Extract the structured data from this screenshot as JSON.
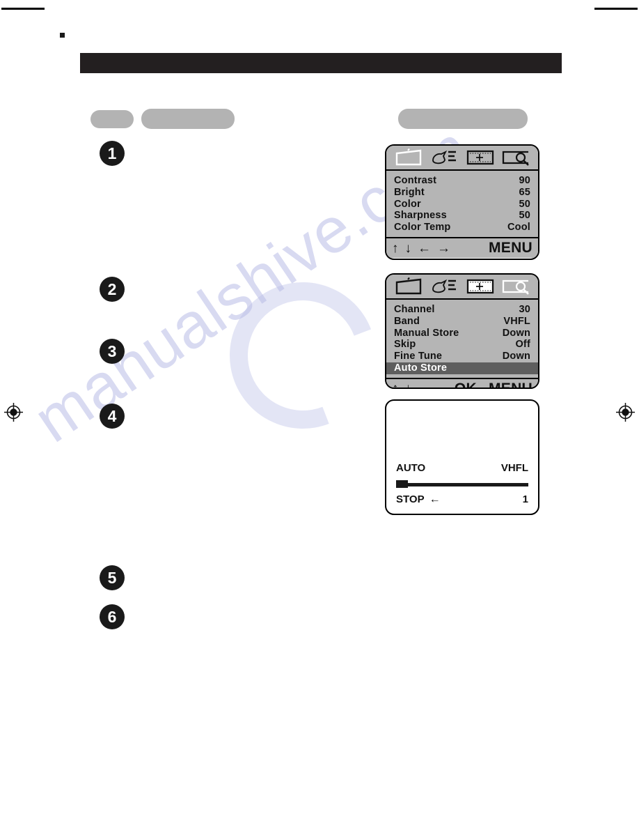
{
  "page": {
    "watermark_text": "manualshive.com",
    "header_bar_color": "#231f20",
    "redacted_color": "#b3b3b3"
  },
  "steps": [
    {
      "number": "1"
    },
    {
      "number": "2"
    },
    {
      "number": "3"
    },
    {
      "number": "4"
    },
    {
      "number": "5"
    },
    {
      "number": "6"
    }
  ],
  "osd_picture_menu": {
    "icons": [
      {
        "name": "picture-icon",
        "selected": true
      },
      {
        "name": "sound-hand-icon",
        "selected": false
      },
      {
        "name": "tuner-icon",
        "selected": false
      },
      {
        "name": "feature-search-icon",
        "selected": false
      }
    ],
    "rows": [
      {
        "label": "Contrast",
        "value": "90",
        "selected": false
      },
      {
        "label": "Bright",
        "value": "65",
        "selected": false
      },
      {
        "label": "Color",
        "value": "50",
        "selected": false
      },
      {
        "label": "Sharpness",
        "value": "50",
        "selected": false
      },
      {
        "label": "Color Temp",
        "value": "Cool",
        "selected": false
      }
    ],
    "footer": {
      "up": "↑",
      "down": "↓",
      "left": "←",
      "right": "→",
      "menu": "MENU"
    }
  },
  "osd_tuner_menu": {
    "icons": [
      {
        "name": "picture-icon",
        "selected": false
      },
      {
        "name": "sound-hand-icon",
        "selected": false
      },
      {
        "name": "tuner-icon",
        "selected": true
      },
      {
        "name": "feature-search-icon",
        "selected": false
      }
    ],
    "rows": [
      {
        "label": "Channel",
        "value": "30",
        "selected": false
      },
      {
        "label": "Band",
        "value": "VHFL",
        "selected": false
      },
      {
        "label": "Manual Store",
        "value": "Down",
        "selected": false
      },
      {
        "label": "Skip",
        "value": "Off",
        "selected": false
      },
      {
        "label": "Fine Tune",
        "value": "Down",
        "selected": false
      },
      {
        "label": "Auto Store",
        "value": "",
        "selected": true
      }
    ],
    "footer": {
      "up": "↑",
      "down": "↓",
      "ok": "OK",
      "menu": "MENU"
    }
  },
  "auto_search_panel": {
    "mode_label": "AUTO",
    "band_value": "VHFL",
    "stop_label": "STOP",
    "stop_arrow": "←",
    "channel_number": "1",
    "progress_percent": 0
  }
}
